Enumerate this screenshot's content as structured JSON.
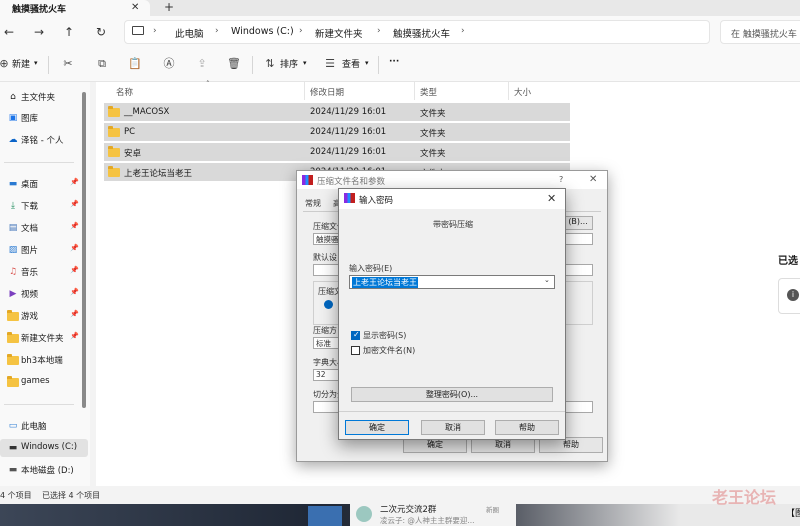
{
  "explorer": {
    "tab_title": "触摸骚扰火车",
    "address": {
      "crumbs": [
        "此电脑",
        "Windows (C:)",
        "新建文件夹",
        "触摸骚扰火车"
      ]
    },
    "search_placeholder": "在 触摸骚扰火车",
    "toolbar": {
      "new_label": "新建",
      "sort_label": "排序",
      "view_label": "查看",
      "more_label": "···"
    },
    "sidebar": {
      "top": [
        {
          "label": "主文件夹",
          "icon": "home-icon"
        },
        {
          "label": "图库",
          "icon": "gallery-icon"
        },
        {
          "label": "泽铭 - 个人",
          "icon": "cloud-icon"
        }
      ],
      "pinned": [
        {
          "label": "桌面",
          "icon": "desktop-icon"
        },
        {
          "label": "下载",
          "icon": "download-icon"
        },
        {
          "label": "文档",
          "icon": "document-icon"
        },
        {
          "label": "图片",
          "icon": "pictures-icon"
        },
        {
          "label": "音乐",
          "icon": "music-icon"
        },
        {
          "label": "视频",
          "icon": "video-icon"
        },
        {
          "label": "游戏",
          "icon": "folder-icon"
        },
        {
          "label": "新建文件夹",
          "icon": "folder-icon"
        },
        {
          "label": "bh3本地端",
          "icon": "folder-icon"
        },
        {
          "label": "games",
          "icon": "folder-icon"
        }
      ],
      "drives": [
        {
          "label": "此电脑",
          "icon": "this-pc-icon"
        },
        {
          "label": "Windows (C:)",
          "icon": "drive-icon"
        },
        {
          "label": "本地磁盘 (D:)",
          "icon": "drive-icon"
        }
      ]
    },
    "columns": {
      "name": "名称",
      "modified": "修改日期",
      "type": "类型",
      "size": "大小"
    },
    "files": [
      {
        "name": "__MACOSX",
        "modified": "2024/11/29 16:01",
        "type": "文件夹"
      },
      {
        "name": "PC",
        "modified": "2024/11/29 16:01",
        "type": "文件夹"
      },
      {
        "name": "安卓",
        "modified": "2024/11/29 16:01",
        "type": "文件夹"
      },
      {
        "name": "上老王论坛当老王",
        "modified": "2024/11/29 16:01",
        "type": "文件夹"
      }
    ],
    "status": {
      "count": "4 个项目",
      "selected": "已选择 4 个项目"
    },
    "right_panel_text": "已选"
  },
  "archive_dialog": {
    "title": "压缩文件名和参数",
    "question_mark": "?",
    "tabs": [
      "常规",
      "高"
    ],
    "labels": {
      "archive_name": "压缩文件",
      "archive_name_value": "触摸骚",
      "browse": "(B)...",
      "default_profile": "默认设",
      "format": "压缩文",
      "method": "压缩方",
      "method_value": "标准",
      "dict": "字典大小",
      "dict_value": "32",
      "split": "切分为分"
    },
    "buttons": {
      "ok": "确定",
      "cancel": "取消",
      "help": "帮助"
    }
  },
  "password_dialog": {
    "title": "输入密码",
    "subtitle": "带密码压缩",
    "password_label": "输入密码(E)",
    "password_value": "上老王论坛当老王",
    "show_password": {
      "label": "显示密码(S)",
      "checked": true
    },
    "encrypt_names": {
      "label": "加密文件名(N)",
      "checked": false
    },
    "organize_button": "整理密码(O)...",
    "buttons": {
      "ok": "确定",
      "cancel": "取消",
      "help": "帮助"
    }
  },
  "taskbar": {
    "snippet_title": "二次元交流2群",
    "snippet_text": "凌云子: @人神主主群要迎...",
    "snippet_badge": "新圈",
    "snippet_tag": "【图"
  },
  "watermark": "老王论坛"
}
